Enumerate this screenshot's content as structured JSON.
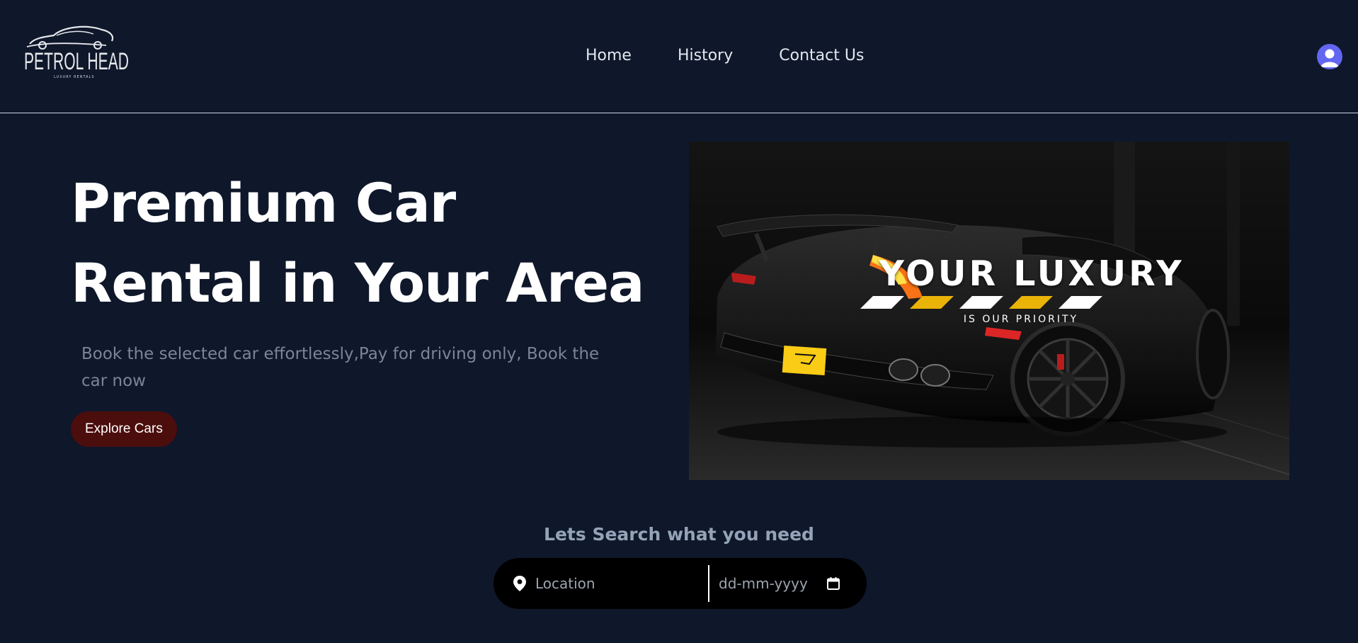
{
  "navbar": {
    "logo": {
      "brand": "PETROL HEAD",
      "tagline": "LUXURY RENTALS"
    },
    "links": [
      {
        "label": "Home"
      },
      {
        "label": "History"
      },
      {
        "label": "Contact Us"
      }
    ],
    "avatar_icon": "user-avatar-icon"
  },
  "hero": {
    "title": "Premium Car Rental in Your Area",
    "description": "Book the selected car effortlessly,Pay for driving only, Book the car now",
    "cta_label": "Explore Cars",
    "image": {
      "banner_title": "YOUR LUXURY",
      "banner_subtitle": "IS OUR PRIORITY",
      "plate_color": "#facc15",
      "stripe_colors": [
        "#ffffff",
        "#eab308"
      ]
    }
  },
  "search": {
    "heading": "Lets Search what you need",
    "location_placeholder": "Location",
    "date_placeholder": "dd-mm-yyyy",
    "location_icon": "map-pin-icon",
    "calendar_icon": "calendar-icon"
  },
  "colors": {
    "background": "#0f172a",
    "cta_background": "#4c0d0d",
    "avatar": "#6366f1",
    "search_bar": "#000000"
  }
}
